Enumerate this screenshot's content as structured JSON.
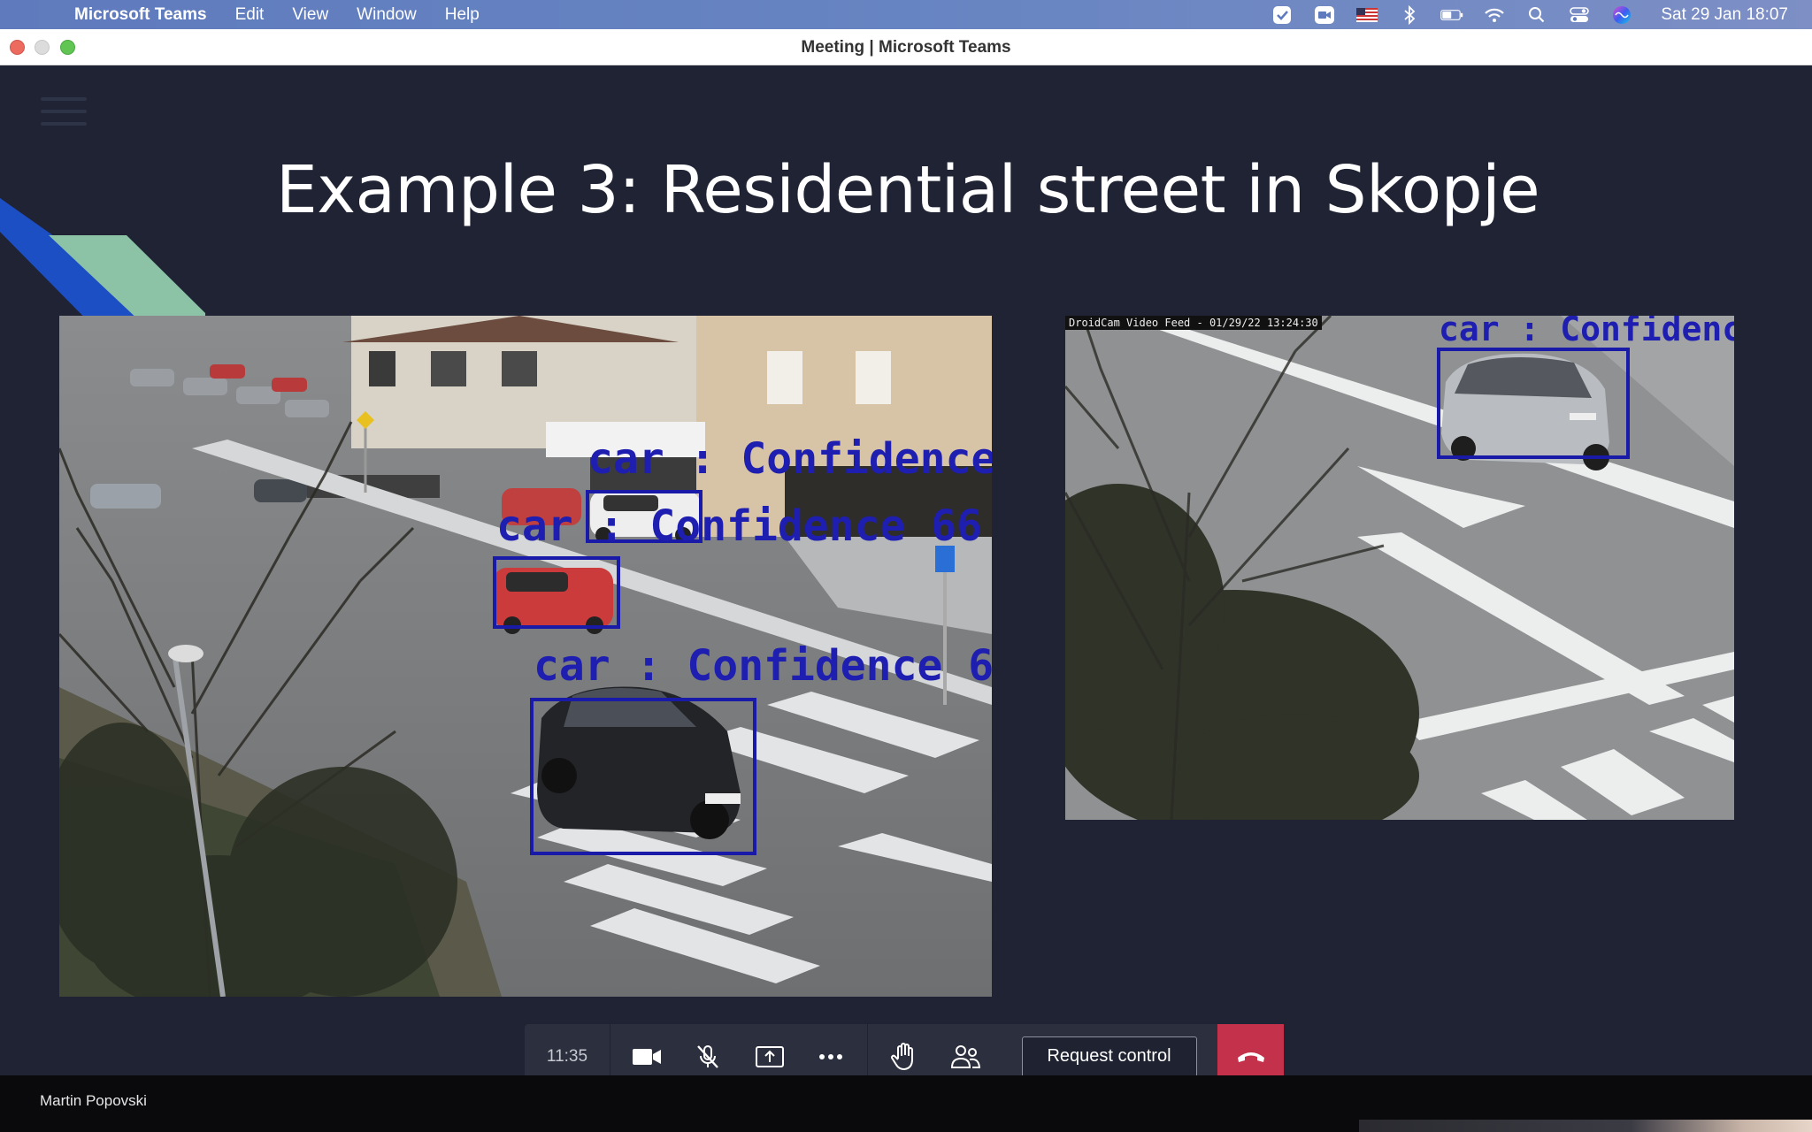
{
  "menubar": {
    "app_name": "Microsoft Teams",
    "menus": [
      "Edit",
      "View",
      "Window",
      "Help"
    ],
    "clock": "Sat 29 Jan  18:07",
    "status_icons": [
      "checkmark-icon",
      "video-icon",
      "us-flag-icon",
      "bluetooth-icon",
      "battery-icon",
      "wifi-icon",
      "spotlight-search-icon",
      "control-center-icon",
      "siri-icon"
    ]
  },
  "window": {
    "title": "Meeting | Microsoft Teams"
  },
  "slide": {
    "title": "Example 3: Residential street in Skopje",
    "left_video": {
      "detections": [
        {
          "label": "car : Confidence"
        },
        {
          "label": "car : Confidence 66"
        },
        {
          "label": "car : Confidence 6"
        }
      ]
    },
    "right_video": {
      "stamp": "DroidCam Video Feed - 01/29/22 13:24:30",
      "detections": [
        {
          "label": "car : Confidence"
        }
      ]
    }
  },
  "callbar": {
    "timer": "11:35",
    "buttons": [
      "camera-icon",
      "mic-off-icon",
      "share-screen-icon",
      "more-icon",
      "raise-hand-icon",
      "participants-icon"
    ],
    "request_control": "Request control"
  },
  "footer": {
    "presenter": "Martin Popovski"
  },
  "colors": {
    "stage_bg": "#1f2334",
    "hangup": "#c4314b",
    "detection_box": "#1a1aa8",
    "deco_blue": "#1d4fc4",
    "deco_green": "#8cc3a6"
  }
}
